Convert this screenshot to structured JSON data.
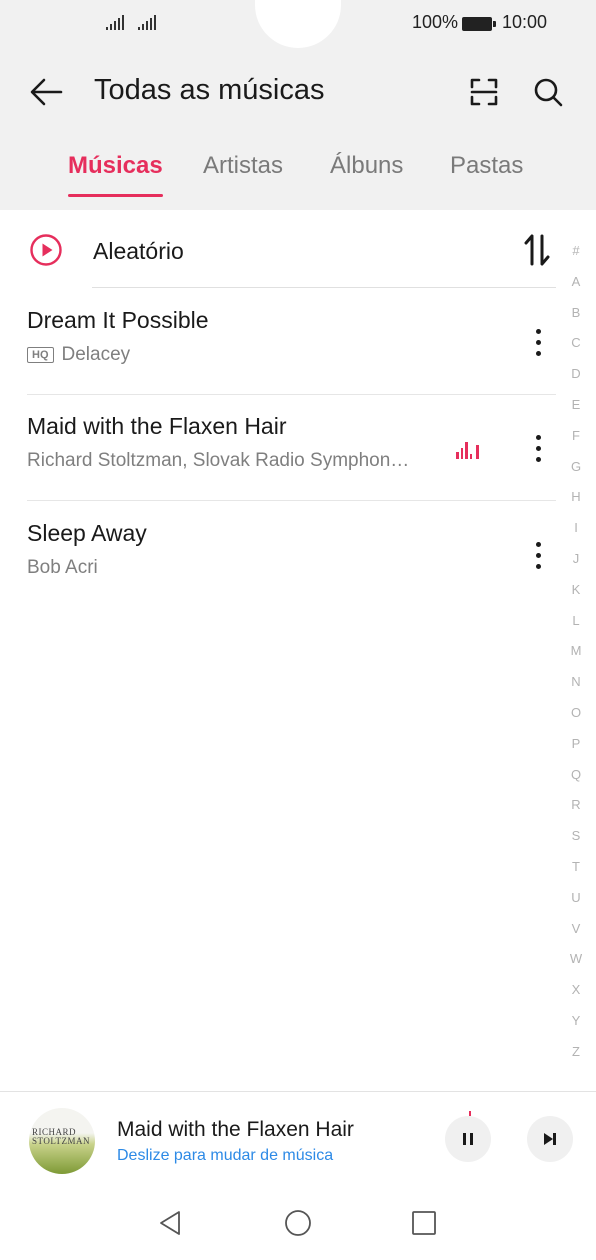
{
  "status_bar": {
    "battery": "100%",
    "time": "10:00"
  },
  "topbar": {
    "title": "Todas as músicas"
  },
  "tabs": [
    {
      "label": "Músicas",
      "active": true
    },
    {
      "label": "Artistas",
      "active": false
    },
    {
      "label": "Álbuns",
      "active": false
    },
    {
      "label": "Pastas",
      "active": false
    }
  ],
  "shuffle": {
    "label": "Aleatório"
  },
  "songs": [
    {
      "title": "Dream It Possible",
      "hq_badge": "HQ",
      "artist": "Delacey"
    },
    {
      "title": "Maid with the Flaxen Hair",
      "artist": "Richard Stoltzman, Slovak Radio Symphon…",
      "playing": true
    },
    {
      "title": "Sleep Away",
      "artist": "Bob Acri"
    }
  ],
  "alphabet": [
    "#",
    "A",
    "B",
    "C",
    "D",
    "E",
    "F",
    "G",
    "H",
    "I",
    "J",
    "K",
    "L",
    "M",
    "N",
    "O",
    "P",
    "Q",
    "R",
    "S",
    "T",
    "U",
    "V",
    "W",
    "X",
    "Y",
    "Z"
  ],
  "now_playing": {
    "title": "Maid with the Flaxen Hair",
    "hint": "Deslize para mudar de música",
    "album_text_line1": "RICHARD",
    "album_text_line2": "STOLTZMAN"
  },
  "colors": {
    "accent": "#e62e5c",
    "link": "#2d8ae6",
    "header_bg": "#f1f1f1"
  },
  "icons": [
    "back-arrow-icon",
    "scan-icon",
    "search-icon",
    "shuffle-play-icon",
    "sort-icon",
    "more-vertical-icon",
    "equalizer-icon",
    "pause-icon",
    "skip-next-icon",
    "nav-back-icon",
    "nav-home-icon",
    "nav-recents-icon"
  ]
}
